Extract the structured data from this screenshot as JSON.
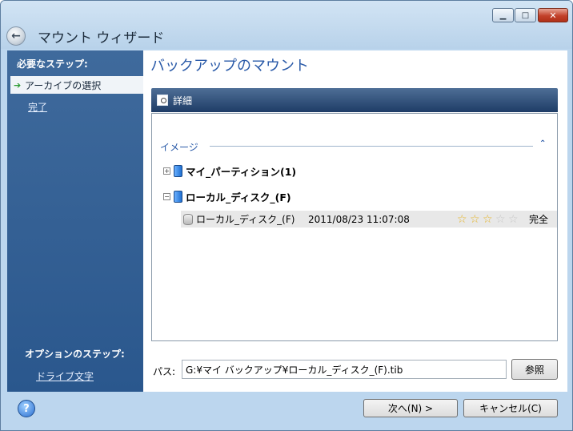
{
  "window": {
    "title": "マウント ウィザード",
    "controls": {
      "min": "▭",
      "max": "□",
      "close": "✕"
    }
  },
  "sidebar": {
    "required_header": "必要なステップ:",
    "steps": [
      {
        "label": "アーカイブの選択",
        "active": true
      },
      {
        "label": "完了",
        "active": false
      }
    ],
    "optional_header": "オプションのステップ:",
    "optional_steps": [
      {
        "label": "ドライブ文字"
      }
    ]
  },
  "main": {
    "page_title": "バックアップのマウント",
    "details_label": "詳細",
    "group_label": "イメージ",
    "tree": [
      {
        "label": "マイ_パーティション(1)",
        "expanded": false
      },
      {
        "label": "ローカル_ディスク_(F)",
        "expanded": true
      }
    ],
    "archive": {
      "name": "ローカル_ディスク_(F)",
      "date": "2011/08/23 11:07:08",
      "rating": 3,
      "rating_max": 5,
      "status": "完全"
    },
    "path_label": "パス:",
    "path_value": "G:¥マイ バックアップ¥ローカル_ディスク_(F).tib",
    "browse_label": "参照"
  },
  "footer": {
    "next_label": "次へ(N) >",
    "cancel_label": "キャンセル(C)"
  },
  "icons": [
    "back-arrow-icon",
    "details-icon",
    "disk-icon",
    "archive-icon",
    "help-icon"
  ]
}
